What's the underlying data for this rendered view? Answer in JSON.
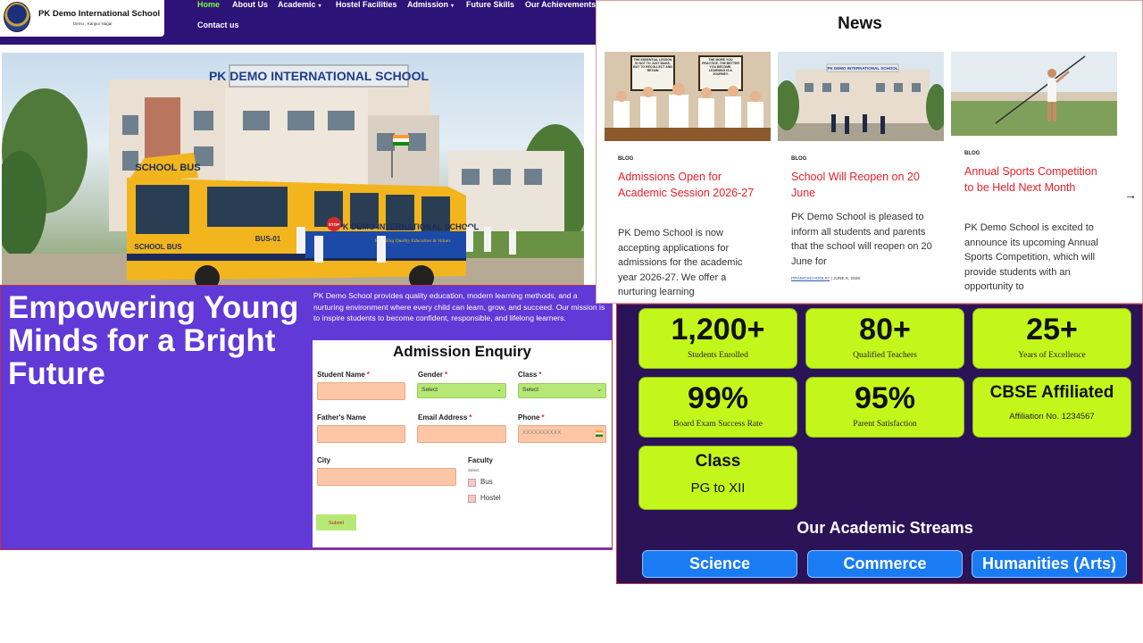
{
  "header": {
    "school_name": "PK Demo International School",
    "school_subtitle": "Demo , Kanpur Nagar",
    "nav": [
      {
        "label": "Home",
        "active": true
      },
      {
        "label": "About Us"
      },
      {
        "label": "Academic",
        "dropdown": true
      },
      {
        "label": "Hostel Facilities"
      },
      {
        "label": "Admission",
        "dropdown": true
      },
      {
        "label": "Future Skills"
      },
      {
        "label": "Our Achievements"
      },
      {
        "label": "Contact us"
      }
    ],
    "colors": {
      "bg": "#2d1378",
      "active": "#7CFC3A"
    }
  },
  "hero": {
    "building_sign": "PK DEMO INTERNATIONAL SCHOOL",
    "bus_label": "SCHOOL BUS",
    "bus_front": "SCHOOL BUS",
    "bus_side_name": "PK DEMO INTERNATIONAL SCHOOL",
    "bus_tagline": "Providing Quality Education & Values",
    "bus_number": "BUS-01",
    "stop_sign": "STOP"
  },
  "banner": {
    "title": "Empowering Young Minds for a Bright Future",
    "description": "PK Demo School provides quality education, modern learning methods, and a nurturing environment where every child can learn, grow, and succeed. Our mission is to inspire students to become confident, responsible, and lifelong learners."
  },
  "form": {
    "title": "Admission Enquiry",
    "student_name": "Student Name",
    "gender": "Gender",
    "gender_value": "Select",
    "class": "Class",
    "class_value": "Select",
    "father_name": "Father's Name",
    "email": "Email Address",
    "phone": "Phone",
    "phone_placeholder": "XXXXXXXXXX",
    "city": "City",
    "faculty": "Faculty",
    "faculty_note": "Select",
    "option_bus": "Bus",
    "option_hostel": "Hostel",
    "required_mark": "*",
    "submit": "Submit"
  },
  "news": {
    "title": "News",
    "cards": [
      {
        "tag": "BLOG",
        "title": "Admissions Open for Academic Session 2026-27",
        "excerpt": "PK Demo School is now accepting applications for admissions for the academic year 2026-27. We offer a nurturing learning",
        "board_left": "THE ESSENTIAL LESSON IS NOT TO JUST MAKE, BUT TO RECOLLECT AND RETAIN",
        "board_right": "THE MORE YOU PRACTICE, THE BETTER YOU BECOME. LEARNING IS A JOURNEY."
      },
      {
        "tag": "BLOG",
        "title": "School Will Reopen on 20 June",
        "excerpt": "PK Demo School is pleased to inform all students and parents that the school will reopen on 20 June for",
        "author": "PRAMOSCHOOL67",
        "date": "JUNE 6, 2026",
        "separator": "|",
        "building_sign": "PK DEMO INTERNATIONAL SCHOOL"
      },
      {
        "tag": "BLOG",
        "title": "Annual Sports Competition to be Held Next Month",
        "excerpt": "PK Demo School is excited to announce its upcoming Annual Sports Competition, which will provide students with an opportunity to"
      }
    ],
    "next_arrow": "→"
  },
  "stats": {
    "items": [
      {
        "value": "1,200+",
        "label": "Students Enrolled"
      },
      {
        "value": "80+",
        "label": "Qualified Teachers"
      },
      {
        "value": "25+",
        "label": "Years of Excellence"
      },
      {
        "value": "99%",
        "label": "Board Exam Success Rate"
      },
      {
        "value": "95%",
        "label": "Parent Satisfaction"
      },
      {
        "value": "CBSE Affiliated",
        "label": "Affiliation No. 1234567"
      }
    ],
    "class_box": {
      "title": "Class",
      "value": "PG to XII"
    },
    "streams_title": "Our Academic Streams",
    "streams": [
      "Science",
      "Commerce",
      "Humanities (Arts)"
    ],
    "colors": {
      "bg": "#2a1457",
      "card": "#c3f71b",
      "stream": "#1a7cf5"
    }
  }
}
